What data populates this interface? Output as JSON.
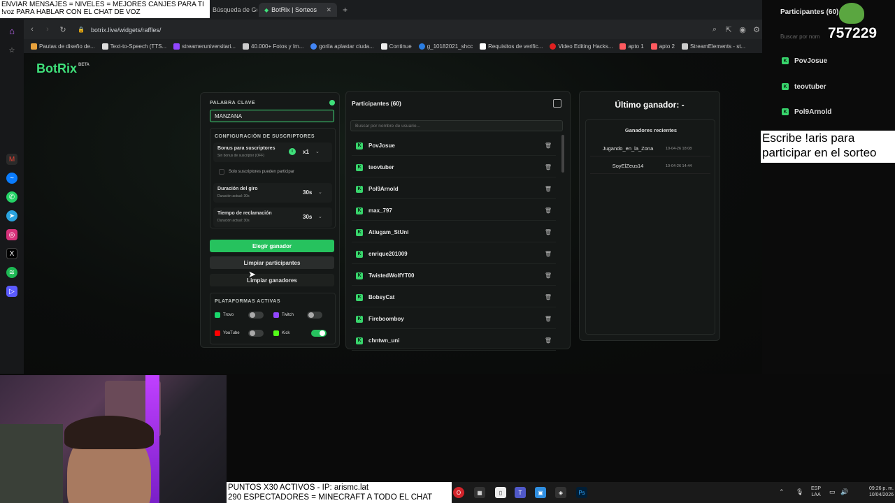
{
  "overlays": {
    "top_line1": "ENVIAR MENSAJES = NIVELES = MEJORES CANJES PARA TI",
    "top_line2": "!voz PARA HABLAR CON EL CHAT DE VOZ",
    "bottom_line1": "PUNTOS X30 ACTIVOS - IP: arismc.lat",
    "bottom_line2": "290 ESPECTADORES = MINECRAFT A TODO EL CHAT",
    "instruction_line1": "Escribe !aris para",
    "instruction_line2": "participar en el sorteo",
    "viewer_count": "757229"
  },
  "browser": {
    "tabs": [
      {
        "label": "Búsqueda de Goo"
      },
      {
        "label": "BotRix | Sorteos"
      }
    ],
    "new_tab": "+",
    "url": "botrix.live/widgets/raffles/",
    "bookmarks": [
      {
        "label": "Pautas de diseño de...",
        "color": "#e8a23c"
      },
      {
        "label": "Text-to-Speech (TTS...",
        "color": "#dddddd"
      },
      {
        "label": "streameruniversitari...",
        "color": "#9146ff"
      },
      {
        "label": "40.000+ Fotos y Im...",
        "color": "#cccccc"
      },
      {
        "label": "gorila aplastar ciuda...",
        "color": "#4285f4"
      },
      {
        "label": "Continue",
        "color": "#eeeeee"
      },
      {
        "label": "g_10182021_shcc",
        "color": "#2a7de1"
      },
      {
        "label": "Requisitos de verific...",
        "color": "#ffffff"
      },
      {
        "label": "Video Editing Hacks...",
        "color": "#e02020"
      },
      {
        "label": "apto 1",
        "color": "#ff5a5f"
      },
      {
        "label": "apto 2",
        "color": "#ff5a5f"
      },
      {
        "label": "StreamElements - st...",
        "color": "#cccccc"
      }
    ]
  },
  "app": {
    "logo": "BotRix",
    "logo_badge": "BETA",
    "keyword_label": "PALABRA CLAVE",
    "keyword_value": "MANZANA",
    "subs_config_label": "CONFIGURACIÓN DE SUSCRIPTORES",
    "subs_bonus_title": "Bonus para suscriptores",
    "subs_bonus_sub": "Sin bonus de suscriptor (OFF)",
    "subs_bonus_value": "x1",
    "subs_only_label": "Solo suscriptores pueden participar",
    "spin_title": "Duración del giro",
    "spin_sub": "Duración actual: 30s",
    "spin_value": "30s",
    "claim_title": "Tiempo de reclamación",
    "claim_sub": "Duración actual: 30s",
    "claim_value": "30s",
    "pick_winner": "Elegir ganador",
    "clear_participants": "Limpiar participantes",
    "clear_winners": "Limpiar ganadores",
    "platforms_label": "PLATAFORMAS ACTIVAS",
    "platforms": [
      {
        "name": "Trovo",
        "on": false,
        "color": "#19d66b"
      },
      {
        "name": "Twitch",
        "on": false,
        "color": "#9146ff"
      },
      {
        "name": "YouTube",
        "on": false,
        "color": "#ff0000"
      },
      {
        "name": "Kick",
        "on": true,
        "color": "#53fc18"
      }
    ],
    "participants_title": "Participantes (60)",
    "search_placeholder": "Buscar por nombre de usuario...",
    "participants": [
      "PovJosue",
      "teovtuber",
      "Pol9Arnold",
      "max_797",
      "Atiugam_StUni",
      "enrique201009",
      "TwistedWolfYT00",
      "BobsyCat",
      "Fireboomboy",
      "chntwn_uni"
    ],
    "last_winner": "Último ganador: -",
    "recent_winners_title": "Ganadores recientes",
    "recent_winners": [
      {
        "name": "Jugando_en_la_Zona",
        "date": "10-04-26 18:08"
      },
      {
        "name": "SoyElZeus14",
        "date": "10-04-26 14:44"
      }
    ]
  },
  "side_widget": {
    "title": "Participantes (60)",
    "search_placeholder": "Buscar por nom",
    "items": [
      "PovJosue",
      "teovtuber",
      "Pol9Arnold"
    ]
  },
  "taskbar": {
    "lang": "ESP",
    "lang_sub": "LAA",
    "time": "09:26 p. m.",
    "date": "10/04/2026"
  }
}
